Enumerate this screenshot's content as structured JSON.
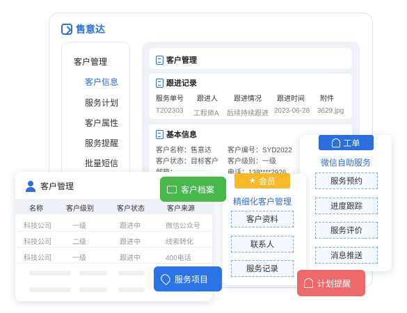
{
  "app": {
    "brand": "售意达"
  },
  "sidebar": {
    "header": "客户管理",
    "items": [
      "客户信息",
      "服务计划",
      "客户属性",
      "服务提醒",
      "批量短信"
    ],
    "active_index": 0
  },
  "main": {
    "title": "客户管理",
    "followup": {
      "title": "跟进记录",
      "headers": [
        "服务单号",
        "跟进人",
        "跟进情况",
        "跟进时间",
        "附件"
      ],
      "row": [
        "T202303",
        "工程师A",
        "后续持续跟进",
        "2023-06-28",
        "3629.jpg"
      ]
    },
    "basic": {
      "title": "基本信息",
      "fields": [
        "客户名称：售意达",
        "客户编号：SYD2022",
        "客户状态：目标客户",
        "客户级别：一级",
        "邮箱：--",
        "电话：138****2926"
      ]
    }
  },
  "customer_card": {
    "title": "客户管理",
    "headers": [
      "名称",
      "客户级别",
      "客户状态",
      "客户来源"
    ],
    "rows": [
      [
        "科技公司",
        "一级",
        "跟进中",
        "微信公众号"
      ],
      [
        "科技公司",
        "二级",
        "跟进中",
        "线索转化"
      ],
      [
        "科技公司",
        "一级",
        "跟进中",
        "400电话"
      ]
    ]
  },
  "member_card": {
    "tag": "会员",
    "subtitle": "精细化客户管理",
    "buttons": [
      "客户资料",
      "联系人",
      "服务记录"
    ]
  },
  "ticket_card": {
    "tag": "工单",
    "subtitle": "微信自助服务",
    "buttons": [
      "服务预约",
      "进度跟踪",
      "服务评价",
      "消息推送"
    ]
  },
  "badges": {
    "archive": "客户档案",
    "service": "服务项目",
    "remind": "计划提醒"
  },
  "colors": {
    "primary": "#2c6fdc",
    "green": "#49b84a",
    "orange": "#f7b928",
    "red": "#ee6a6a"
  }
}
